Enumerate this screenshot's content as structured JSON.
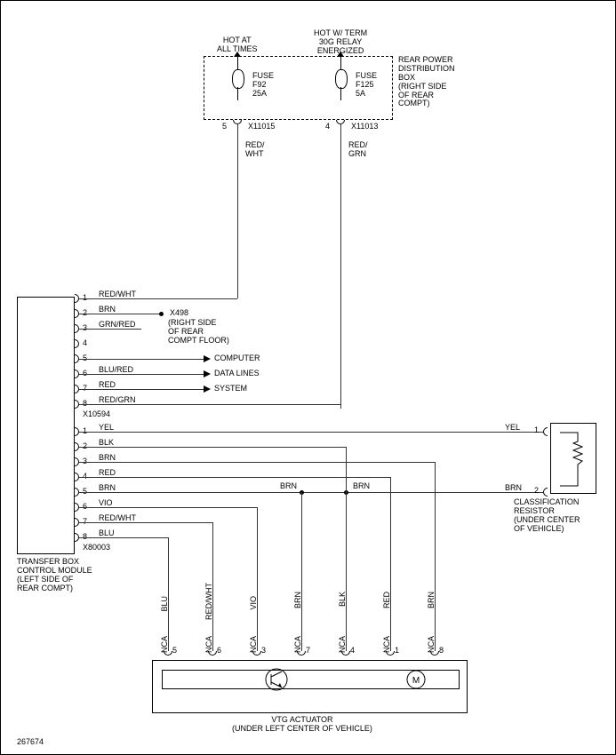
{
  "header_labels": {
    "hot_at_all_times": "HOT AT\nALL TIMES",
    "hot_w_term": "HOT W/ TERM\n30G RELAY\nENERGIZED"
  },
  "fuse_box": {
    "fuse1": {
      "label": "FUSE\nF92\n25A"
    },
    "fuse2": {
      "label": "FUSE\nF125\n5A"
    },
    "box_label": "REAR POWER\nDISTRIBUTION\nBOX\n(RIGHT SIDE\nOF REAR\nCOMPT)",
    "pin5": "5",
    "conn5": "X11015",
    "pin4": "4",
    "conn4": "X11013",
    "wire1": "RED/\nWHT",
    "wire2": "RED/\nGRN"
  },
  "transfer_module": {
    "label": "TRANSFER BOX\nCONTROL MODULE\n(LEFT SIDE OF\nREAR COMPT)",
    "connector_a": {
      "id": "X10594",
      "pins": [
        {
          "n": "1",
          "wire": "RED/WHT"
        },
        {
          "n": "2",
          "wire": "BRN"
        },
        {
          "n": "3",
          "wire": "GRN/RED"
        },
        {
          "n": "4",
          "wire": ""
        },
        {
          "n": "5",
          "wire": ""
        },
        {
          "n": "6",
          "wire": "BLU/RED"
        },
        {
          "n": "7",
          "wire": "RED"
        },
        {
          "n": "8",
          "wire": "RED/GRN"
        }
      ]
    },
    "connector_b": {
      "id": "X80003",
      "pins": [
        {
          "n": "1",
          "wire": "YEL"
        },
        {
          "n": "2",
          "wire": "BLK"
        },
        {
          "n": "3",
          "wire": "BRN"
        },
        {
          "n": "4",
          "wire": "RED"
        },
        {
          "n": "5",
          "wire": "BRN"
        },
        {
          "n": "6",
          "wire": "VIO"
        },
        {
          "n": "7",
          "wire": "RED/WHT"
        },
        {
          "n": "8",
          "wire": "BLU"
        }
      ]
    }
  },
  "ground": {
    "conn": "X498",
    "label": "(RIGHT SIDE\nOF REAR\nCOMPT FLOOR)"
  },
  "arrows": {
    "computer": "COMPUTER",
    "data_lines": "DATA LINES",
    "system": "SYSTEM"
  },
  "classification_resistor": {
    "label": "CLASSIFICATION\nRESISTOR\n(UNDER CENTER\nOF VEHICLE)",
    "pin1": "1",
    "pin2": "2",
    "wire1": "YEL",
    "wire2": "BRN"
  },
  "mid_brn": {
    "left": "BRN",
    "right": "BRN"
  },
  "vtg_actuator": {
    "label": "VTG ACTUATOR\n(UNDER LEFT CENTER OF VEHICLE)",
    "pins": [
      {
        "nca": "NCA",
        "n": "5",
        "wire": "BLU"
      },
      {
        "nca": "NCA",
        "n": "6",
        "wire": "RED/WHT"
      },
      {
        "nca": "NCA",
        "n": "3",
        "wire": "VIO"
      },
      {
        "nca": "NCA",
        "n": "7",
        "wire": "BRN"
      },
      {
        "nca": "NCA",
        "n": "4",
        "wire": "BLK"
      },
      {
        "nca": "NCA",
        "n": "1",
        "wire": "RED"
      },
      {
        "nca": "NCA",
        "n": "8",
        "wire": "BRN"
      }
    ]
  },
  "footer": "267674"
}
